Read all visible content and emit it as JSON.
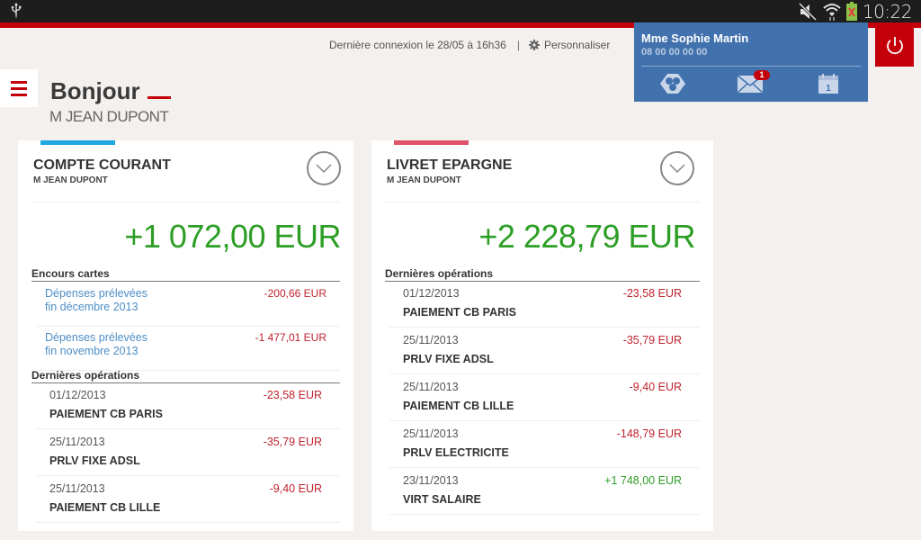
{
  "status_bar": {
    "time": "10:22",
    "icons": [
      "usb-icon",
      "mute-icon",
      "wifi-icon",
      "battery-icon"
    ]
  },
  "header": {
    "last_login": "Dernière connexion le 28/05 à 16h36",
    "separator": "|",
    "customize_label": "Personnaliser",
    "greeting": "Bonjour",
    "user_name": "M JEAN DUPONT"
  },
  "advisor": {
    "name": "Mme Sophie Martin",
    "phone": "08 00 00 00 00",
    "message_badge": "1",
    "calendar_day": "1",
    "icons": [
      "contact-icon",
      "mail-icon",
      "calendar-icon"
    ]
  },
  "colors": {
    "brand_red": "#c4000b",
    "advisor_blue": "#4272ad",
    "positive_green": "#2d9e25",
    "negative_red": "#c0212c",
    "link_blue": "#4c8ec6",
    "account1_accent": "#1ea7e1",
    "account2_accent": "#e0546a"
  },
  "accounts": [
    {
      "title": "COMPTE COURANT",
      "holder": "M JEAN DUPONT",
      "balance": "+1 072,00 EUR",
      "card_section": "Encours cartes",
      "card_items": [
        {
          "label_line1": "Dépenses prélevées",
          "label_line2": "fin décembre 2013",
          "amount": "-200,66 EUR"
        },
        {
          "label_line1": "Dépenses prélevées",
          "label_line2": "fin novembre 2013",
          "amount": "-1 477,01 EUR"
        }
      ],
      "ops_section": "Dernières opérations",
      "operations": [
        {
          "date": "01/12/2013",
          "label": "PAIEMENT CB PARIS",
          "amount": "-23,58 EUR",
          "positive": false
        },
        {
          "date": "25/11/2013",
          "label": "PRLV FIXE ADSL",
          "amount": "-35,79 EUR",
          "positive": false
        },
        {
          "date": "25/11/2013",
          "label": "PAIEMENT CB LILLE",
          "amount": "-9,40 EUR",
          "positive": false
        }
      ]
    },
    {
      "title": "LIVRET EPARGNE",
      "holder": "M JEAN DUPONT",
      "balance": "+2 228,79 EUR",
      "ops_section": "Dernières opérations",
      "operations": [
        {
          "date": "01/12/2013",
          "label": "PAIEMENT CB PARIS",
          "amount": "-23,58 EUR",
          "positive": false
        },
        {
          "date": "25/11/2013",
          "label": "PRLV FIXE ADSL",
          "amount": "-35,79 EUR",
          "positive": false
        },
        {
          "date": "25/11/2013",
          "label": "PAIEMENT CB LILLE",
          "amount": "-9,40 EUR",
          "positive": false
        },
        {
          "date": "25/11/2013",
          "label": "PRLV ELECTRICITE",
          "amount": "-148,79 EUR",
          "positive": false
        },
        {
          "date": "23/11/2013",
          "label": "VIRT SALAIRE",
          "amount": "+1 748,00 EUR",
          "positive": true
        }
      ]
    }
  ]
}
